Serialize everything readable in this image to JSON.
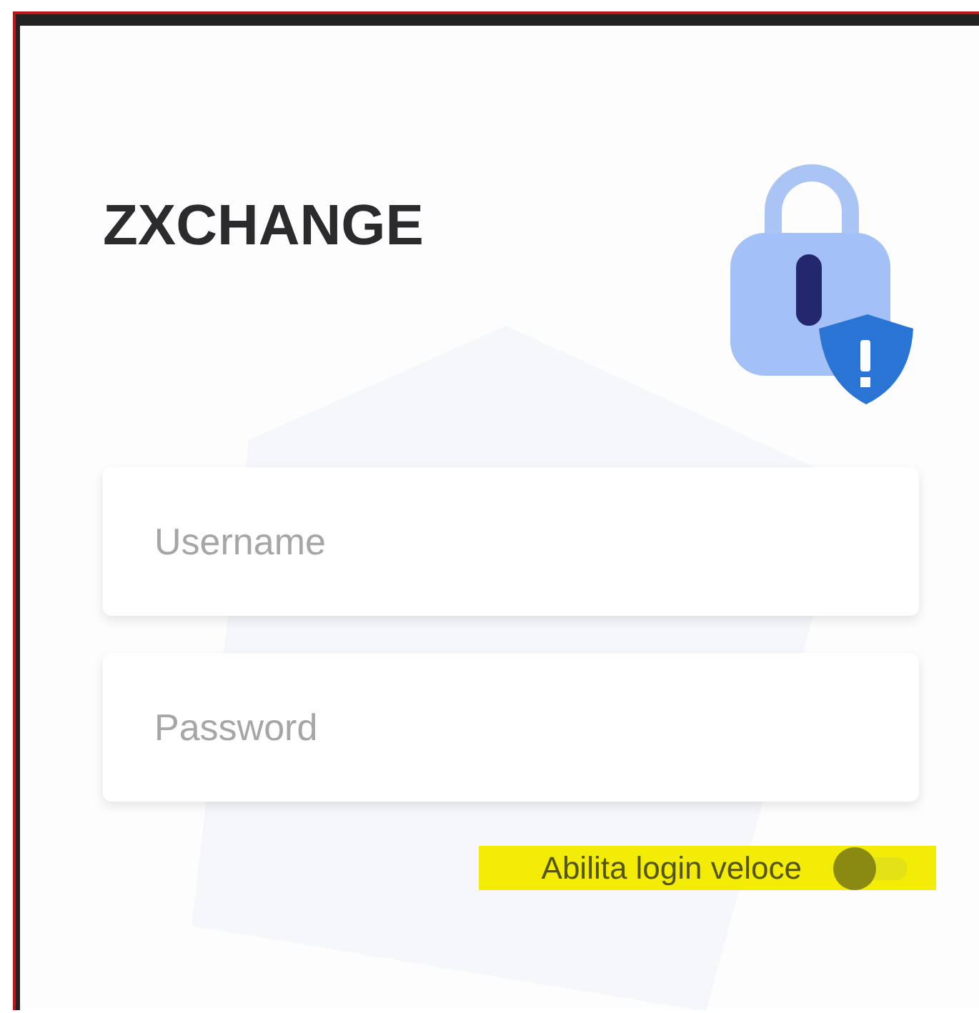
{
  "app": {
    "title": "ZXCHANGE"
  },
  "fields": [
    {
      "placeholder": "Username"
    },
    {
      "placeholder": "Password"
    }
  ],
  "quick_login": {
    "label": "Abilita login veloce",
    "on": false,
    "highlighted": true
  }
}
